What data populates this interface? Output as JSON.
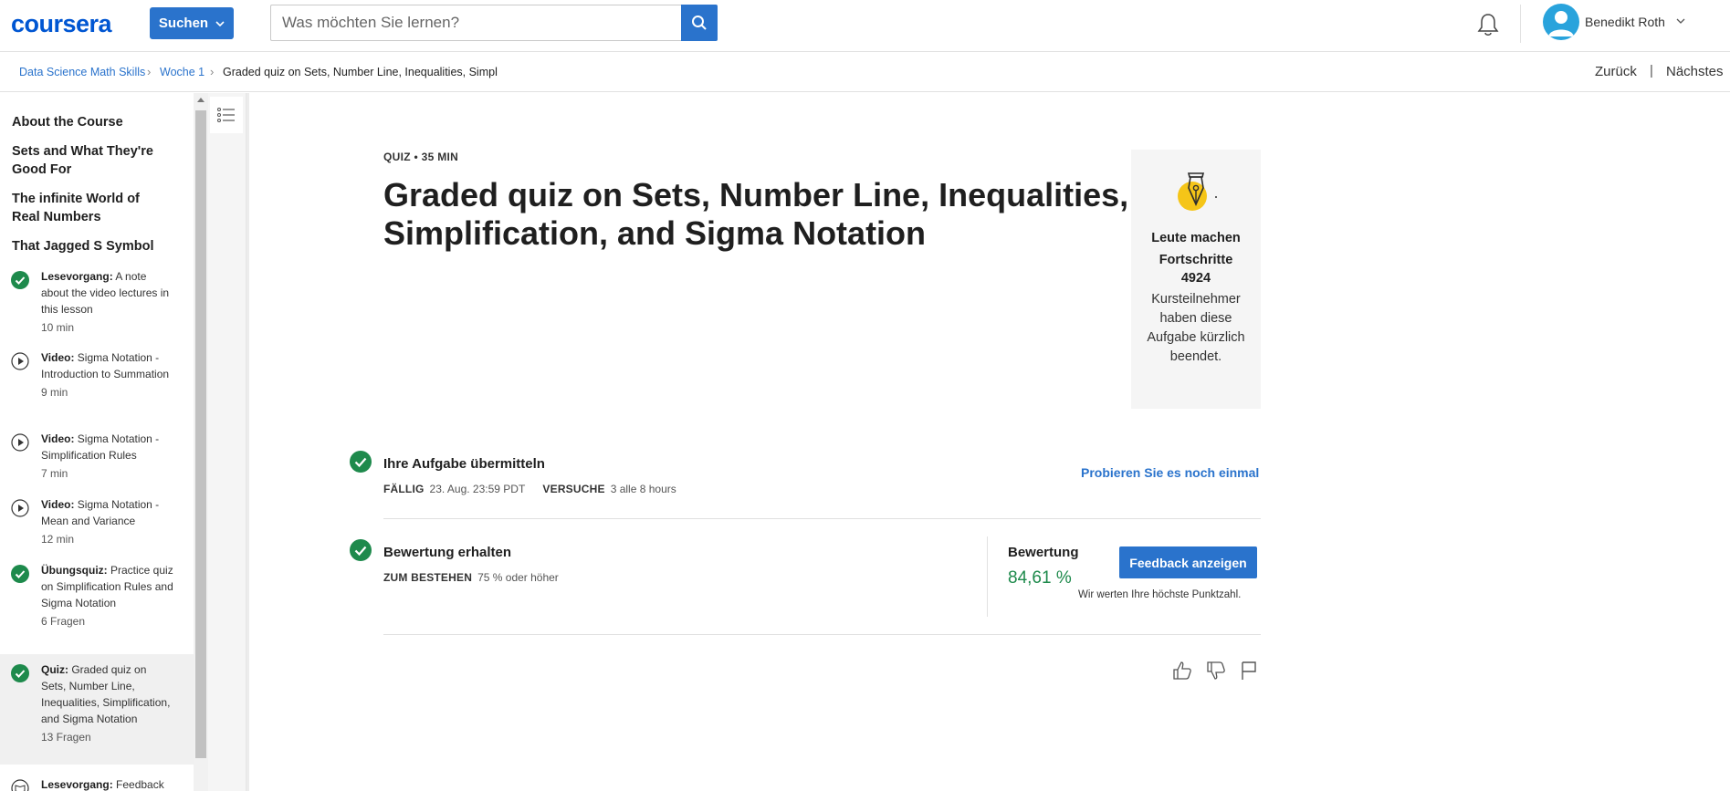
{
  "header": {
    "logo": "coursera",
    "search_button_label": "Suchen",
    "search_placeholder": "Was möchten Sie lernen?",
    "user_name": "Benedikt Roth",
    "icons": [
      "chevron-down-icon",
      "search-icon",
      "bell-icon",
      "avatar-icon"
    ]
  },
  "breadcrumb": {
    "items": [
      "Data Science Math Skills",
      "Woche 1",
      "Graded quiz on Sets, Number Line, Inequalities, Simpl"
    ],
    "separator": "›",
    "back_label": "Zurück",
    "divider": "|",
    "next_label": "Nächstes"
  },
  "sidebar": {
    "sections": [
      "About the Course",
      "Sets and What They're Good For",
      "The infinite World of Real Numbers",
      "That Jagged S Symbol"
    ],
    "items": [
      {
        "type": "Lesevorgang:",
        "title": "A note about the video lectures in this lesson",
        "duration": "10 min",
        "icon": "check-circle-icon"
      },
      {
        "type": "Video:",
        "title": "Sigma Notation - Introduction to Summation",
        "duration": "9 min",
        "icon": "play-circle-icon"
      },
      {
        "type": "Video:",
        "title": "Sigma Notation - Simplification Rules",
        "duration": "7 min",
        "icon": "play-circle-icon"
      },
      {
        "type": "Video:",
        "title": "Sigma Notation - Mean and Variance",
        "duration": "12 min",
        "icon": "play-circle-icon"
      },
      {
        "type": "Übungsquiz:",
        "title": "Practice quiz on Simplification Rules and Sigma Notation",
        "duration": "6 Fragen",
        "icon": "check-circle-icon"
      },
      {
        "type": "Quiz:",
        "title": "Graded quiz on Sets, Number Line, Inequalities, Simplification, and Sigma Notation",
        "duration": "13 Fragen",
        "icon": "check-circle-icon"
      },
      {
        "type": "Lesevorgang:",
        "title": "Feedback",
        "duration": "",
        "icon": "reading-icon"
      }
    ]
  },
  "main": {
    "meta": "QUIZ • 35 MIN",
    "title": "Graded quiz on Sets, Number Line, Inequalities, Simplification, and Sigma Notation",
    "progress_card": {
      "title": "Leute machen Fortschritte",
      "count": "4924",
      "description": "Kursteilnehmer haben diese Aufgabe kürzlich beendet.",
      "icon": "pen-nib-icon"
    },
    "step1": {
      "title": "Ihre Aufgabe übermitteln",
      "due_label": "FÄLLIG",
      "due_value": "23. Aug. 23:59 PDT",
      "attempts_label": "VERSUCHE",
      "attempts_value": "3 alle 8 hours",
      "retry_label": "Probieren Sie es noch einmal"
    },
    "step2": {
      "title": "Bewertung erhalten",
      "pass_label": "ZUM BESTEHEN",
      "pass_value": "75 % oder höher",
      "grade_label": "Bewertung",
      "grade_value": "84,61 %",
      "feedback_button": "Feedback anzeigen",
      "grade_note": "Wir werten Ihre höchste Punktzahl."
    },
    "reactions": [
      "thumbs-up-icon",
      "thumbs-down-icon",
      "flag-icon"
    ]
  },
  "colors": {
    "brand": "#0056d2",
    "primary_button": "#2a73cc",
    "success": "#1e8a4c",
    "progress_accent": "#f5c518"
  }
}
